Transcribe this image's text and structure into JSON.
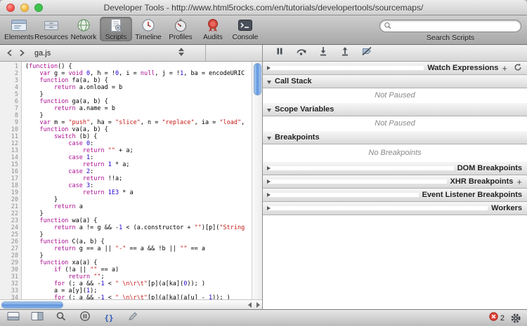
{
  "window": {
    "title": "Developer Tools - http://www.html5rocks.com/en/tutorials/developertools/sourcemaps/"
  },
  "toolbar": {
    "active": "Scripts",
    "items": [
      {
        "name": "elements",
        "label": "Elements",
        "icon": "elements-icon"
      },
      {
        "name": "resources",
        "label": "Resources",
        "icon": "resources-icon"
      },
      {
        "name": "network",
        "label": "Network",
        "icon": "network-icon"
      },
      {
        "name": "scripts",
        "label": "Scripts",
        "icon": "scripts-icon"
      },
      {
        "name": "timeline",
        "label": "Timeline",
        "icon": "timeline-icon"
      },
      {
        "name": "profiles",
        "label": "Profiles",
        "icon": "profiles-icon"
      },
      {
        "name": "audits",
        "label": "Audits",
        "icon": "audits-icon"
      },
      {
        "name": "console",
        "label": "Console",
        "icon": "console-icon"
      }
    ],
    "search": {
      "value": "",
      "label": "Search Scripts",
      "icon": "search-icon"
    }
  },
  "filebar": {
    "filename": "ga.js"
  },
  "debugger": {
    "buttons": [
      "pause",
      "step-over",
      "step-into",
      "step-out",
      "toggle-breakpoints"
    ]
  },
  "code": {
    "lines": [
      [
        [
          "pl",
          "("
        ],
        [
          "kw",
          "function"
        ],
        [
          "pl",
          "() {"
        ]
      ],
      [
        [
          "pl",
          "    "
        ],
        [
          "kw",
          "var"
        ],
        [
          "pl",
          " g = "
        ],
        [
          "kw",
          "void"
        ],
        [
          "pl",
          " "
        ],
        [
          "nu",
          "0"
        ],
        [
          "pl",
          ", h = !"
        ],
        [
          "nu",
          "0"
        ],
        [
          "pl",
          ", i = "
        ],
        [
          "kw",
          "null"
        ],
        [
          "pl",
          ", j = !"
        ],
        [
          "nu",
          "1"
        ],
        [
          "pl",
          ", ba = encodeURIC"
        ]
      ],
      [
        [
          "pl",
          "    "
        ],
        [
          "kw",
          "function"
        ],
        [
          "pl",
          " fa(a, b) {"
        ]
      ],
      [
        [
          "pl",
          "        "
        ],
        [
          "kw",
          "return"
        ],
        [
          "pl",
          " a.onload = b"
        ]
      ],
      [
        [
          "pl",
          "    }"
        ]
      ],
      [
        [
          "pl",
          "    "
        ],
        [
          "kw",
          "function"
        ],
        [
          "pl",
          " ga(a, b) {"
        ]
      ],
      [
        [
          "pl",
          "        "
        ],
        [
          "kw",
          "return"
        ],
        [
          "pl",
          " a.name = b"
        ]
      ],
      [
        [
          "pl",
          "    }"
        ]
      ],
      [
        [
          "pl",
          "    "
        ],
        [
          "kw",
          "var"
        ],
        [
          "pl",
          " m = "
        ],
        [
          "st",
          "\"push\""
        ],
        [
          "pl",
          ", ha = "
        ],
        [
          "st",
          "\"slice\""
        ],
        [
          "pl",
          ", n = "
        ],
        [
          "st",
          "\"replace\""
        ],
        [
          "pl",
          ", ia = "
        ],
        [
          "st",
          "\"load\""
        ],
        [
          "pl",
          ", "
        ]
      ],
      [
        [
          "pl",
          "    "
        ],
        [
          "kw",
          "function"
        ],
        [
          "pl",
          " va(a, b) {"
        ]
      ],
      [
        [
          "pl",
          "        "
        ],
        [
          "kw",
          "switch"
        ],
        [
          "pl",
          " (b) {"
        ]
      ],
      [
        [
          "pl",
          "            "
        ],
        [
          "kw",
          "case"
        ],
        [
          "pl",
          " "
        ],
        [
          "nu",
          "0"
        ],
        [
          "pl",
          ":"
        ]
      ],
      [
        [
          "pl",
          "                "
        ],
        [
          "kw",
          "return"
        ],
        [
          "pl",
          " "
        ],
        [
          "st",
          "\"\""
        ],
        [
          "pl",
          " + a;"
        ]
      ],
      [
        [
          "pl",
          "            "
        ],
        [
          "kw",
          "case"
        ],
        [
          "pl",
          " "
        ],
        [
          "nu",
          "1"
        ],
        [
          "pl",
          ":"
        ]
      ],
      [
        [
          "pl",
          "                "
        ],
        [
          "kw",
          "return"
        ],
        [
          "pl",
          " "
        ],
        [
          "nu",
          "1"
        ],
        [
          "pl",
          " * a;"
        ]
      ],
      [
        [
          "pl",
          "            "
        ],
        [
          "kw",
          "case"
        ],
        [
          "pl",
          " "
        ],
        [
          "nu",
          "2"
        ],
        [
          "pl",
          ":"
        ]
      ],
      [
        [
          "pl",
          "                "
        ],
        [
          "kw",
          "return"
        ],
        [
          "pl",
          " !!a;"
        ]
      ],
      [
        [
          "pl",
          "            "
        ],
        [
          "kw",
          "case"
        ],
        [
          "pl",
          " "
        ],
        [
          "nu",
          "3"
        ],
        [
          "pl",
          ":"
        ]
      ],
      [
        [
          "pl",
          "                "
        ],
        [
          "kw",
          "return"
        ],
        [
          "pl",
          " "
        ],
        [
          "nu",
          "1E3"
        ],
        [
          "pl",
          " * a"
        ]
      ],
      [
        [
          "pl",
          "        }"
        ]
      ],
      [
        [
          "pl",
          "        "
        ],
        [
          "kw",
          "return"
        ],
        [
          "pl",
          " a"
        ]
      ],
      [
        [
          "pl",
          "    }"
        ]
      ],
      [
        [
          "pl",
          "    "
        ],
        [
          "kw",
          "function"
        ],
        [
          "pl",
          " wa(a) {"
        ]
      ],
      [
        [
          "pl",
          "        "
        ],
        [
          "kw",
          "return"
        ],
        [
          "pl",
          " a != g && -"
        ],
        [
          "nu",
          "1"
        ],
        [
          "pl",
          " < (a.constructor + "
        ],
        [
          "st",
          "\"\""
        ],
        [
          "pl",
          ")[p]("
        ],
        [
          "st",
          "\"String"
        ]
      ],
      [
        [
          "pl",
          "    }"
        ]
      ],
      [
        [
          "pl",
          "    "
        ],
        [
          "kw",
          "function"
        ],
        [
          "pl",
          " C(a, b) {"
        ]
      ],
      [
        [
          "pl",
          "        "
        ],
        [
          "kw",
          "return"
        ],
        [
          "pl",
          " g == a || "
        ],
        [
          "st",
          "\"-\""
        ],
        [
          "pl",
          " == a && !b || "
        ],
        [
          "st",
          "\"\""
        ],
        [
          "pl",
          " == a"
        ]
      ],
      [
        [
          "pl",
          "    }"
        ]
      ],
      [
        [
          "pl",
          "    "
        ],
        [
          "kw",
          "function"
        ],
        [
          "pl",
          " xa(a) {"
        ]
      ],
      [
        [
          "pl",
          "        "
        ],
        [
          "kw",
          "if"
        ],
        [
          "pl",
          " (!a || "
        ],
        [
          "st",
          "\"\""
        ],
        [
          "pl",
          " == a)"
        ]
      ],
      [
        [
          "pl",
          "            "
        ],
        [
          "kw",
          "return"
        ],
        [
          "pl",
          " "
        ],
        [
          "st",
          "\"\""
        ],
        [
          "pl",
          ";"
        ]
      ],
      [
        [
          "pl",
          "        "
        ],
        [
          "kw",
          "for"
        ],
        [
          "pl",
          " (; a && -"
        ],
        [
          "nu",
          "1"
        ],
        [
          "pl",
          " < "
        ],
        [
          "st",
          "\" \\n\\r\\t\""
        ],
        [
          "pl",
          "[p](a[ka]("
        ],
        [
          "nu",
          "0"
        ],
        [
          "pl",
          ")); )"
        ]
      ],
      [
        [
          "pl",
          "        a = a[y]("
        ],
        [
          "nu",
          "1"
        ],
        [
          "pl",
          ");"
        ]
      ],
      [
        [
          "pl",
          "        "
        ],
        [
          "kw",
          "for"
        ],
        [
          "pl",
          " (; a && -"
        ],
        [
          "nu",
          "1"
        ],
        [
          "pl",
          " < "
        ],
        [
          "st",
          "\" \\n\\r\\t\""
        ],
        [
          "pl",
          "[p](a[ka](a[u] - "
        ],
        [
          "nu",
          "1"
        ],
        [
          "pl",
          ")); )"
        ]
      ]
    ]
  },
  "sidebar": {
    "sections": [
      {
        "label": "Watch Expressions",
        "state": "collapsed",
        "actions": [
          "add",
          "refresh"
        ]
      },
      {
        "label": "Call Stack",
        "state": "expanded",
        "message": "Not Paused"
      },
      {
        "label": "Scope Variables",
        "state": "expanded",
        "message": "Not Paused"
      },
      {
        "label": "Breakpoints",
        "state": "expanded",
        "message": "No Breakpoints"
      },
      {
        "label": "DOM Breakpoints",
        "state": "collapsed"
      },
      {
        "label": "XHR Breakpoints",
        "state": "collapsed",
        "actions": [
          "add"
        ]
      },
      {
        "label": "Event Listener Breakpoints",
        "state": "collapsed"
      },
      {
        "label": "Workers",
        "state": "collapsed"
      }
    ]
  },
  "statusbar": {
    "buttons": [
      "console-toggle",
      "dock",
      "search",
      "pause-on-exceptions",
      "pretty-print",
      "edit"
    ],
    "pretty_print_label": "{}",
    "error_count": "2"
  },
  "colors": {
    "keyword": "#aa0d91",
    "number": "#1c00cf",
    "string": "#c41a16"
  }
}
